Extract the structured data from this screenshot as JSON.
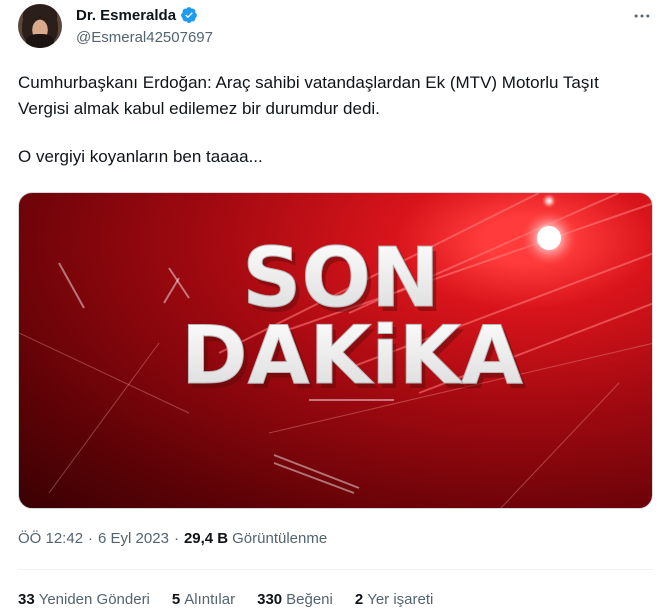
{
  "author": {
    "display_name": "Dr. Esmeralda",
    "handle": "@Esmeral42507697",
    "verified": true,
    "verified_color": "#1d9bf0"
  },
  "more_icon": "more-horizontal-icon",
  "tweet": {
    "line1": "Cumhurbaşkanı Erdoğan: Araç sahibi vatandaşlardan Ek (MTV) Motorlu Taşıt Vergisi almak kabul edilemez bir durumdur dedi.",
    "line2": "O vergiyi koyanların ben taaaa..."
  },
  "media": {
    "headline_top": "SON",
    "headline_bottom": "DAKiKA"
  },
  "meta": {
    "time": "ÖÖ 12:42",
    "date": "6 Eyl 2023",
    "separator": "·",
    "views_count": "29,4 B",
    "views_label": "Görüntülenme"
  },
  "stats": {
    "retweets_count": "33",
    "retweets_label": "Yeniden Gönderi",
    "quotes_count": "5",
    "quotes_label": "Alıntılar",
    "likes_count": "330",
    "likes_label": "Beğeni",
    "bookmarks_count": "2",
    "bookmarks_label": "Yer işareti"
  }
}
